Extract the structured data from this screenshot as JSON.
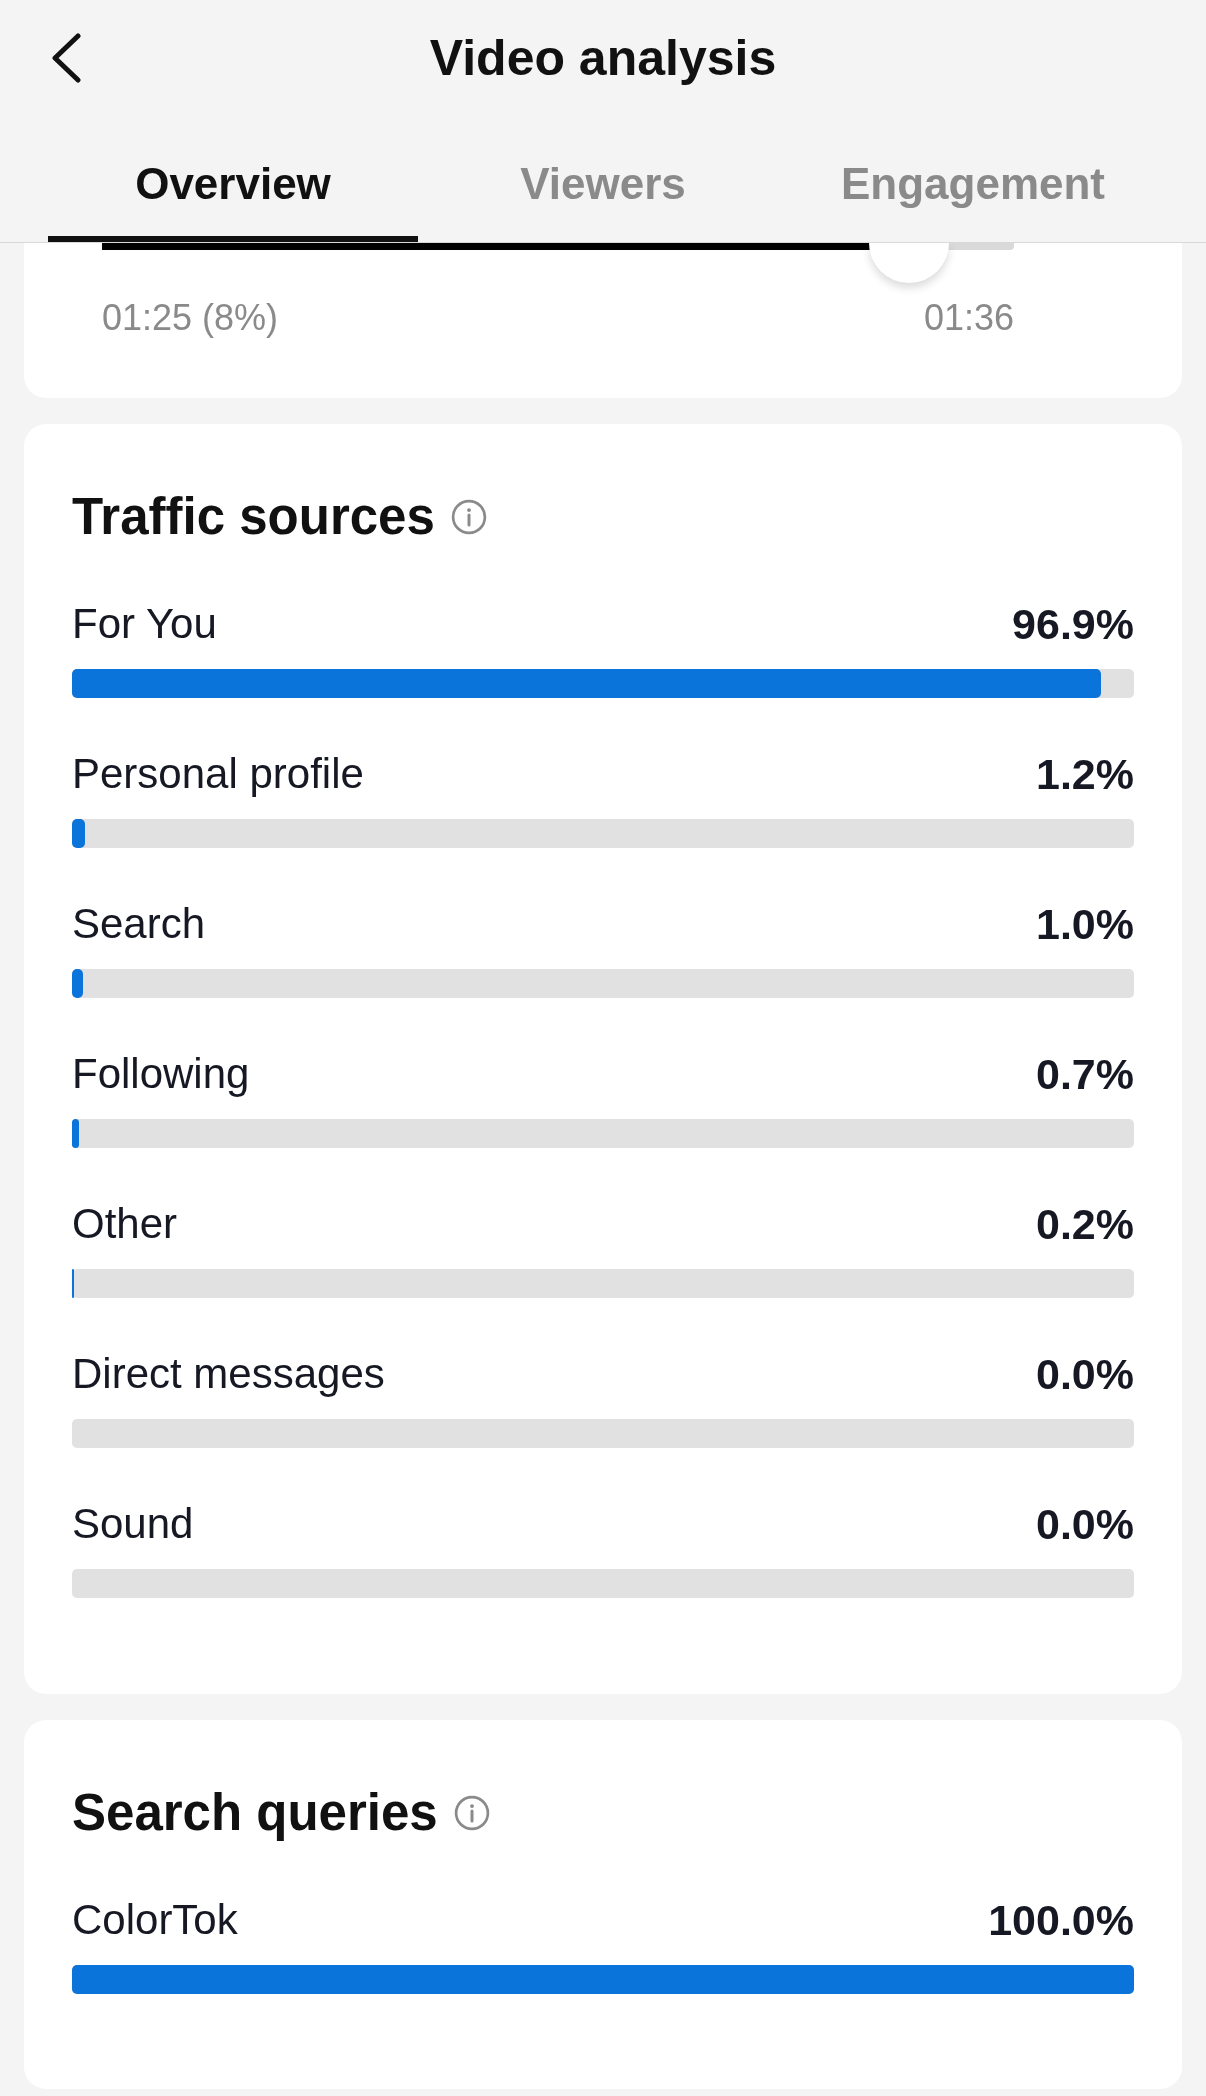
{
  "header": {
    "title": "Video analysis"
  },
  "tabs": [
    {
      "label": "Overview",
      "selected": true
    },
    {
      "label": "Viewers",
      "selected": false
    },
    {
      "label": "Engagement",
      "selected": false
    }
  ],
  "retention": {
    "level": 0.885,
    "current_time": "01:25 (8%)",
    "end_time": "01:36"
  },
  "sections": [
    {
      "title": "Traffic sources",
      "rows": [
        {
          "label": "For You",
          "value": "96.9%",
          "level": 0.969
        },
        {
          "label": "Personal profile",
          "value": "1.2%",
          "level": 0.012
        },
        {
          "label": "Search",
          "value": "1.0%",
          "level": 0.01
        },
        {
          "label": "Following",
          "value": "0.7%",
          "level": 0.007
        },
        {
          "label": "Other",
          "value": "0.2%",
          "level": 0.002
        },
        {
          "label": "Direct messages",
          "value": "0.0%"
        },
        {
          "label": "Sound",
          "value": "0.0%"
        }
      ]
    },
    {
      "title": "Search queries",
      "rows": [
        {
          "label": "ColorTok",
          "value": "100.0%",
          "level": 1
        }
      ]
    }
  ]
}
